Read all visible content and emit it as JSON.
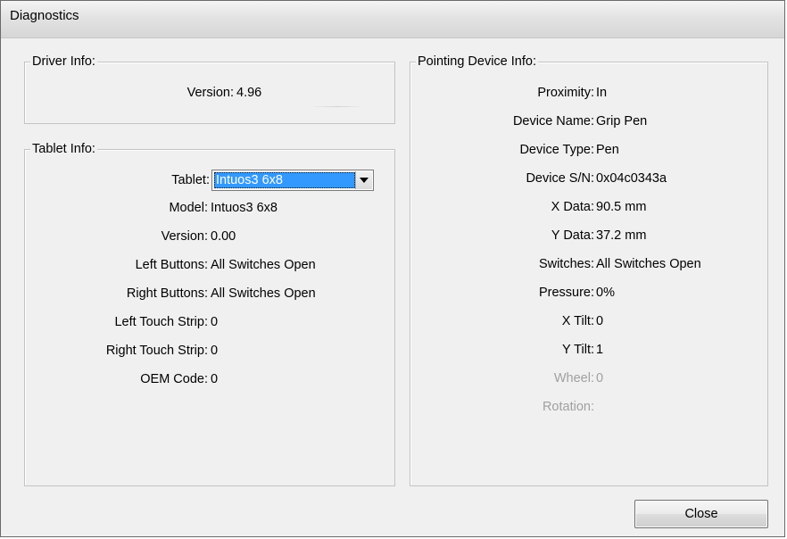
{
  "window": {
    "title": "Diagnostics"
  },
  "driver_info": {
    "legend": "Driver Info:",
    "version_label": "Version:",
    "version_value": "4.96"
  },
  "tablet_info": {
    "legend": "Tablet Info:",
    "tablet_label": "Tablet:",
    "tablet_selected": "Intuos3 6x8",
    "rows": [
      {
        "label": "Model:",
        "value": "Intuos3 6x8"
      },
      {
        "label": "Version:",
        "value": "0.00"
      },
      {
        "label": "Left Buttons:",
        "value": "All Switches Open"
      },
      {
        "label": "Right Buttons:",
        "value": "All Switches Open"
      },
      {
        "label": "Left Touch Strip:",
        "value": "0"
      },
      {
        "label": "Right Touch Strip:",
        "value": "0"
      },
      {
        "label": "OEM Code:",
        "value": "0"
      }
    ]
  },
  "pointing_device_info": {
    "legend": "Pointing Device Info:",
    "rows": [
      {
        "label": "Proximity:",
        "value": "In",
        "enabled": true
      },
      {
        "label": "Device Name:",
        "value": "Grip Pen",
        "enabled": true
      },
      {
        "label": "Device Type:",
        "value": "Pen",
        "enabled": true
      },
      {
        "label": "Device S/N:",
        "value": "0x04c0343a",
        "enabled": true
      },
      {
        "label": "X Data:",
        "value": "90.5 mm",
        "enabled": true
      },
      {
        "label": "Y Data:",
        "value": "37.2 mm",
        "enabled": true
      },
      {
        "label": "Switches:",
        "value": "All Switches Open",
        "enabled": true
      },
      {
        "label": "Pressure:",
        "value": "0%",
        "enabled": true
      },
      {
        "label": "X Tilt:",
        "value": "0",
        "enabled": true
      },
      {
        "label": "Y Tilt:",
        "value": "1",
        "enabled": true
      },
      {
        "label": "Wheel:",
        "value": "0",
        "enabled": false
      },
      {
        "label": "Rotation:",
        "value": "",
        "enabled": false
      }
    ]
  },
  "buttons": {
    "close_label": "Close"
  },
  "colors": {
    "selection": "#3399ff",
    "disabled_text": "#a0a0a0",
    "window_bg": "#f0f0f0"
  }
}
